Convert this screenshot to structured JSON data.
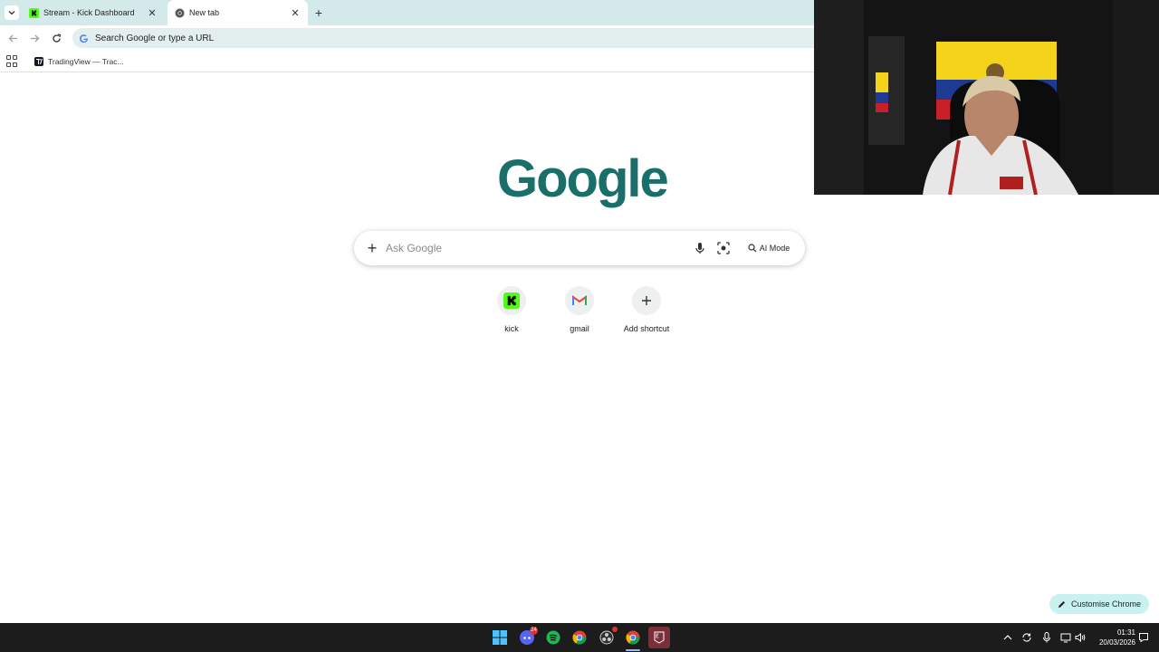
{
  "browser": {
    "tabs": [
      {
        "title": "Stream - Kick Dashboard",
        "icon": "kick-favicon",
        "active": false
      },
      {
        "title": "New tab",
        "icon": "chrome-favicon",
        "active": true
      }
    ],
    "omnibox": {
      "text": "Search Google or type a URL"
    },
    "bookmarks": [
      {
        "label": "TradingView — Trac...",
        "icon": "tradingview-favicon"
      }
    ]
  },
  "page": {
    "logo_text": "Google",
    "search": {
      "placeholder": "Ask Google",
      "ai_mode_label": "AI Mode"
    },
    "shortcuts": [
      {
        "label": "kick",
        "icon": "kick-icon"
      },
      {
        "label": "gmail",
        "icon": "gmail-icon"
      },
      {
        "label": "Add shortcut",
        "icon": "plus-icon"
      }
    ],
    "customise_label": "Customise Chrome"
  },
  "taskbar": {
    "apps": [
      "windows-start-icon",
      "discord-icon",
      "spotify-icon",
      "chrome-icon",
      "obs-icon",
      "chrome-profile-icon",
      "epic-games-icon"
    ],
    "discord_badge": "24",
    "time": "01:31",
    "date": "20/03/2026"
  },
  "colors": {
    "accent": "#1a6f6b",
    "tabstrip": "#d4eaea",
    "taskbar": "#1c1c1c",
    "customise_bg": "#c8f1f0"
  }
}
